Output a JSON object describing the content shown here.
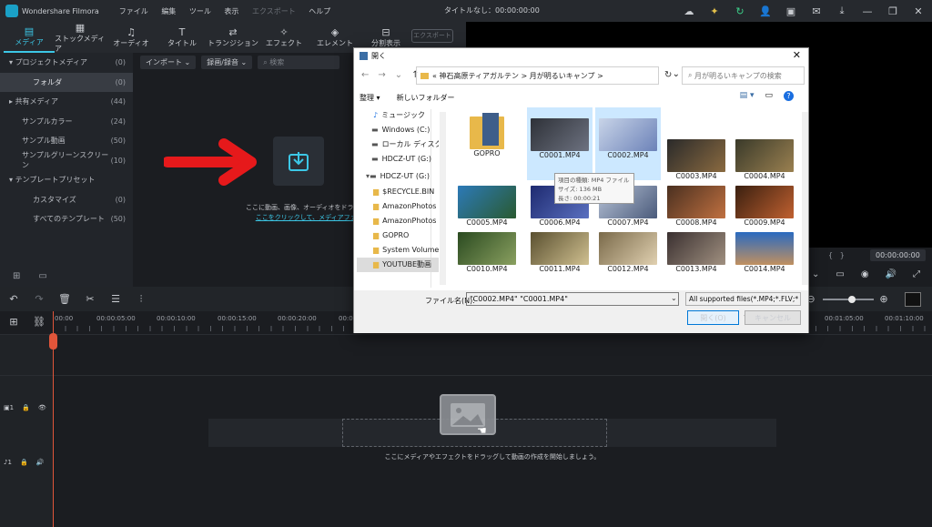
{
  "titlebar": {
    "app_name": "Wondershare Filmora",
    "menu": [
      "ファイル",
      "編集",
      "ツール",
      "表示",
      "エクスポート",
      "ヘルプ"
    ],
    "doc_title": "タイトルなし：00:00:00:00"
  },
  "toolbar": {
    "tabs": [
      {
        "label": "メディア",
        "icon": "media-icon"
      },
      {
        "label": "ストックメディア",
        "icon": "stock-media-icon"
      },
      {
        "label": "オーディオ",
        "icon": "music-icon"
      },
      {
        "label": "タイトル",
        "icon": "title-icon"
      },
      {
        "label": "トランジション",
        "icon": "transition-icon"
      },
      {
        "label": "エフェクト",
        "icon": "effect-icon"
      },
      {
        "label": "エレメント",
        "icon": "element-icon"
      },
      {
        "label": "分割表示",
        "icon": "split-screen-icon"
      }
    ],
    "export_label": "エクスポート"
  },
  "sidebar": {
    "items": [
      {
        "label": "プロジェクトメディア",
        "count": "(0)",
        "level": "root"
      },
      {
        "label": "フォルダ",
        "count": "(0)",
        "level": "child",
        "selected": true
      },
      {
        "label": "共有メディア",
        "count": "(44)",
        "level": "root"
      },
      {
        "label": "サンプルカラー",
        "count": "(24)",
        "level": "child"
      },
      {
        "label": "サンプル動画",
        "count": "(50)",
        "level": "child"
      },
      {
        "label": "サンプルグリーンスクリーン",
        "count": "(10)",
        "level": "child"
      },
      {
        "label": "テンプレートプリセット",
        "count": "",
        "level": "root"
      },
      {
        "label": "カスタマイズ",
        "count": "(0)",
        "level": "child"
      },
      {
        "label": "すべてのテンプレート",
        "count": "(50)",
        "level": "child"
      }
    ]
  },
  "media": {
    "import_label": "インポート",
    "record_label": "録画/録音",
    "search_placeholder": "検索",
    "drop_text": "ここに動画、画像、オーディオをドラッグ＆ドロップしてく",
    "drop_link": "ここをクリックして、メディアファイルを追加してく"
  },
  "preview": {
    "timecode": "00:00:00:00"
  },
  "ruler": {
    "ticks": [
      "00:00",
      "00:00:05:00",
      "00:00:10:00",
      "00:00:15:00",
      "00:00:20:00",
      "00:00:2",
      "00:01:05:00",
      "00:01:10:00"
    ]
  },
  "timeline": {
    "message": "ここにメディアやエフェクトをドラッグして動画の作成を開始しましょう。",
    "video_track": "1",
    "audio_track": "1"
  },
  "dialog": {
    "title": "開く",
    "breadcrumb": [
      "«",
      "神石高原ティアガルテン",
      ">",
      "月が明るいキャンプ",
      ">"
    ],
    "search_placeholder": "月が明るいキャンプの検索",
    "organize": "整理",
    "new_folder": "新しいフォルダー",
    "tree": [
      {
        "label": "ミュージック",
        "icon": "music-icon"
      },
      {
        "label": "Windows (C:)",
        "icon": "drive-icon"
      },
      {
        "label": "ローカル ディスク (D",
        "icon": "drive-icon"
      },
      {
        "label": "HDCZ-UT (G:)",
        "icon": "drive-icon"
      },
      {
        "label": "HDCZ-UT (G:)",
        "icon": "drive-icon"
      },
      {
        "label": "$RECYCLE.BIN",
        "icon": "folder-icon"
      },
      {
        "label": "AmazonPhotos (",
        "icon": "folder-icon"
      },
      {
        "label": "AmazonPhotos (",
        "icon": "folder-icon"
      },
      {
        "label": "GOPRO",
        "icon": "folder-icon"
      },
      {
        "label": "System Volume I",
        "icon": "folder-icon"
      },
      {
        "label": "YOUTUBE動画",
        "icon": "folder-icon"
      }
    ],
    "files": [
      {
        "name": "GOPRO",
        "type": "folder",
        "color": "#e8b84a"
      },
      {
        "name": "C0001.MP4",
        "type": "video",
        "color": "#4a4f5a",
        "selected": true
      },
      {
        "name": "C0002.MP4",
        "type": "video",
        "color": "#6c82b8",
        "selected": true
      },
      {
        "name": "C0003.MP4",
        "type": "video",
        "color": "#5a4a3a"
      },
      {
        "name": "C0004.MP4",
        "type": "video",
        "color": "#6b5a40"
      },
      {
        "name": "C0005.MP4",
        "type": "video",
        "color": "#3e6a8a"
      },
      {
        "name": "C0006.MP4",
        "type": "video",
        "color": "#2c3a78"
      },
      {
        "name": "C0007.MP4",
        "type": "video",
        "color": "#7a8aa0"
      },
      {
        "name": "C0008.MP4",
        "type": "video",
        "color": "#6a4030"
      },
      {
        "name": "C0009.MP4",
        "type": "video",
        "color": "#7a4a2a"
      },
      {
        "name": "C0010.MP4",
        "type": "video",
        "color": "#4a6a30"
      },
      {
        "name": "C0011.MP4",
        "type": "video",
        "color": "#8a7a50"
      },
      {
        "name": "C0012.MP4",
        "type": "video",
        "color": "#9a8a6a"
      },
      {
        "name": "C0013.MP4",
        "type": "video",
        "color": "#5a4a40"
      },
      {
        "name": "C0014.MP4",
        "type": "video",
        "color": "#3a6aa8"
      }
    ],
    "tooltip": [
      "項目の種類: MP4 ファイル",
      "サイズ: 136 MB",
      "長さ: 00:00:21"
    ],
    "filename_label": "ファイル名(N):",
    "filename_value": "\"C0002.MP4\" \"C0001.MP4\"",
    "filetype_value": "All supported files(*.MP4;*.FLV;*",
    "open_label": "開く(O)",
    "cancel_label": "キャンセル"
  }
}
